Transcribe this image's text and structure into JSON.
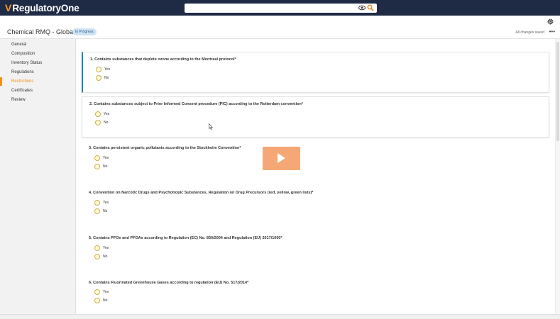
{
  "app": {
    "logo_text": "RegulatoryOne",
    "logo_mark": "V"
  },
  "search": {
    "placeholder": "",
    "eye_icon": "eye-icon",
    "search_icon": "search-icon"
  },
  "header": {
    "title": "Chemical RMQ - Global",
    "status_badge": "In Progress",
    "saved_text": "All changes saved",
    "more_label": "•••"
  },
  "sidebar": {
    "items": [
      {
        "label": "General",
        "active": false
      },
      {
        "label": "Composition",
        "active": false
      },
      {
        "label": "Inventory Status",
        "active": false
      },
      {
        "label": "Regulations",
        "active": false
      },
      {
        "label": "Restrictions",
        "active": true
      },
      {
        "label": "Certificates",
        "active": false
      },
      {
        "label": "Review",
        "active": false
      }
    ]
  },
  "questions": [
    {
      "text": "1. Contains substances that deplete ozone according to the Montreal protocol*",
      "yes": "Yes",
      "no": "No"
    },
    {
      "text": "2. Contains substances subject to Prior Informed Consent procedure (PIC) according to the Rotterdam convention*",
      "yes": "Yes",
      "no": "No"
    },
    {
      "text": "3. Contains persistent organic pollutants according to the Stockholm Convention*",
      "yes": "Yes",
      "no": "No"
    },
    {
      "text": "4. Convention on Narcotic Drugs and Psychotropic Substances, Regulation on Drug Precursors (red, yellow, green lists)*",
      "yes": "Yes",
      "no": "No"
    },
    {
      "text": "5. Contains PFOs and PFOAs according to Regulation (EC) No. 850/2004 and Regulation (EU) 2017/1000*",
      "yes": "Yes",
      "no": "No"
    },
    {
      "text": "6. Contains Fluorinated Greenhouse Gases according to regulation (EU) No. 517/2014*",
      "yes": "Yes",
      "no": "No"
    }
  ],
  "colors": {
    "topbar": "#1f2a44",
    "brand_accent": "#f29b2f",
    "active_nav": "#f0911e",
    "badge_bg": "#cfe3f3",
    "current_card_border": "#1a8bb0",
    "play_overlay": "#f5a876"
  }
}
